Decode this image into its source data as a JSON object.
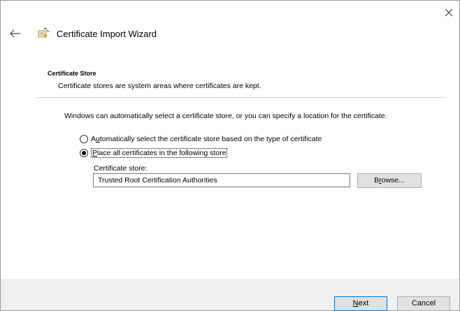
{
  "window": {
    "title": "Certificate Import Wizard",
    "close_icon": "close-icon",
    "back_icon": "back-arrow-icon",
    "wizard_icon": "certificate-icon"
  },
  "section": {
    "title": "Certificate Store",
    "description": "Certificate stores are system areas where certificates are kept."
  },
  "intro": "Windows can automatically select a certificate store, or you can specify a location for the certificate.",
  "options": {
    "auto": {
      "label_pre": "A",
      "label_key": "u",
      "label_post": "tomatically select the certificate store based on the type of certificate",
      "checked": false
    },
    "place": {
      "label_pre": "",
      "label_key": "P",
      "label_post": "lace all certificates in the following store",
      "checked": true
    }
  },
  "store": {
    "label": "Certificate store:",
    "value": "Trusted Root Certification Authorities"
  },
  "buttons": {
    "browse_pre": "B",
    "browse_key": "r",
    "browse_post": "owse...",
    "next_pre": "",
    "next_key": "N",
    "next_post": "ext",
    "cancel": "Cancel"
  }
}
